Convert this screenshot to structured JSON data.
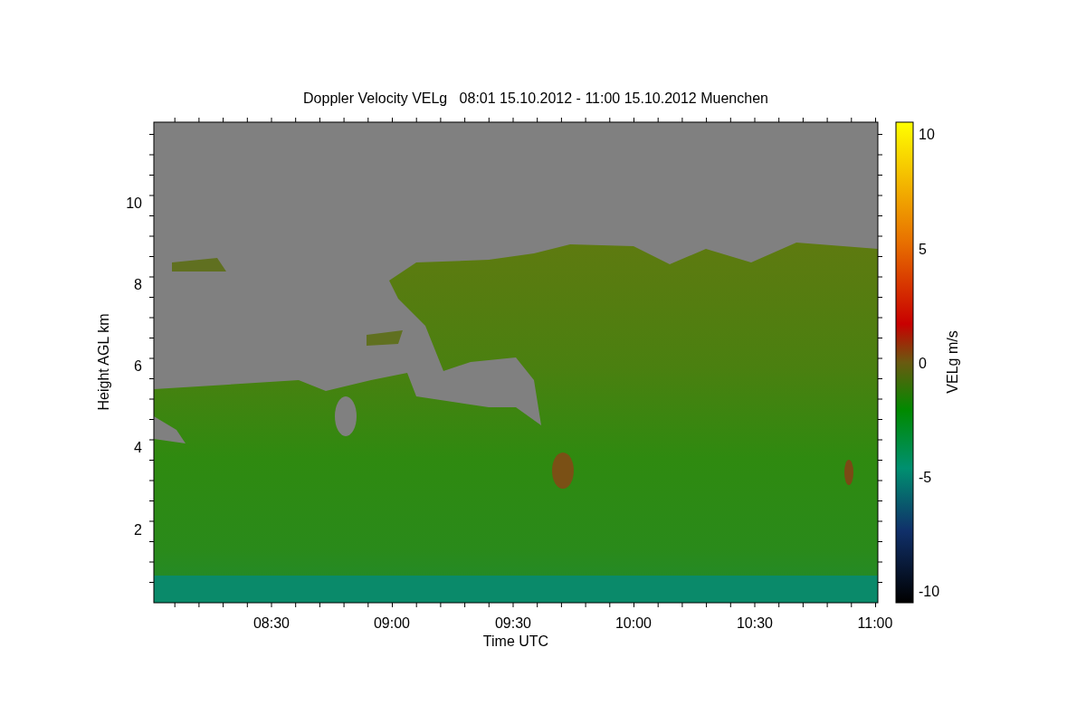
{
  "plot": {
    "title": "Doppler Velocity VELg   08:01 15.10.2012 - 11:00 15.10.2012 Muenchen",
    "ylabel": "Height AGL km",
    "yticks": [
      "10",
      "8",
      "6",
      "4",
      "2"
    ],
    "xlabel": "Time UTC",
    "xticks": [
      "08:30",
      "09:00",
      "09:30",
      "10:00",
      "10:30",
      "11:00"
    ]
  },
  "colorbar": {
    "label": "VELg m/s",
    "ticks": [
      "10",
      "5",
      "0",
      "-5",
      "-10"
    ]
  }
}
